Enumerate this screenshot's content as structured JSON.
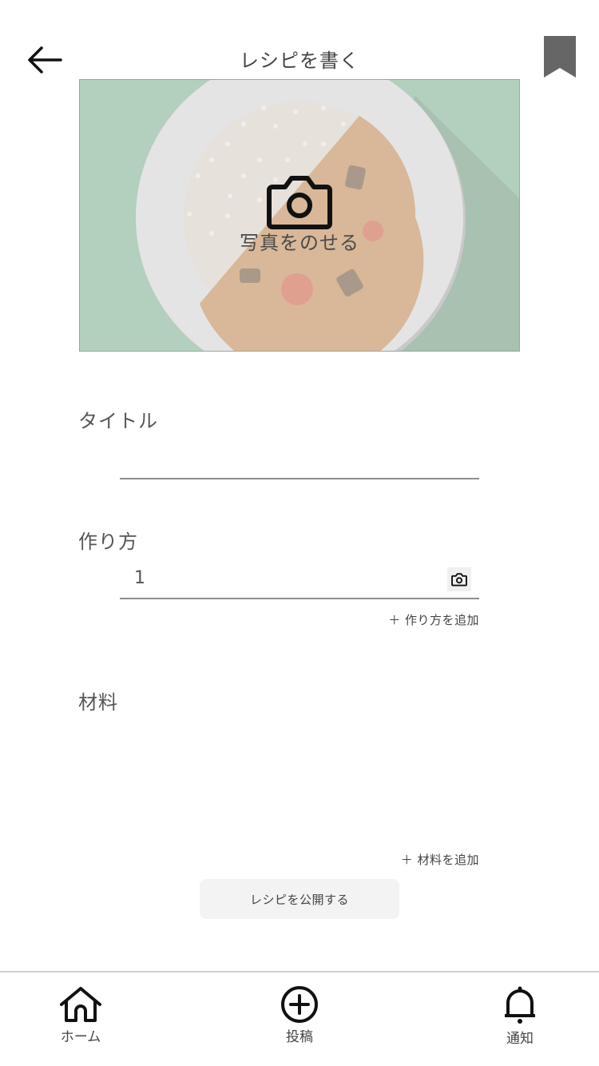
{
  "header": {
    "title": "レシピを書く"
  },
  "photo": {
    "label": "写真をのせる"
  },
  "title_section": {
    "label": "タイトル",
    "value": "",
    "placeholder": ""
  },
  "steps_section": {
    "label": "作り方",
    "steps": [
      {
        "number": "1",
        "value": ""
      }
    ],
    "add_label": "＋ 作り方を追加"
  },
  "ingredients_section": {
    "label": "材料",
    "add_label": "＋ 材料を追加"
  },
  "publish_label": "レシピを公開する",
  "tabs": [
    {
      "label": "ホーム",
      "icon": "home-icon"
    },
    {
      "label": "投稿",
      "icon": "plus-circle-icon"
    },
    {
      "label": "通知",
      "icon": "bell-icon"
    }
  ],
  "colors": {
    "text": "#444444",
    "divider": "#8d8d8d",
    "bookmark": "#666666",
    "button_bg": "#f3f3f3"
  }
}
